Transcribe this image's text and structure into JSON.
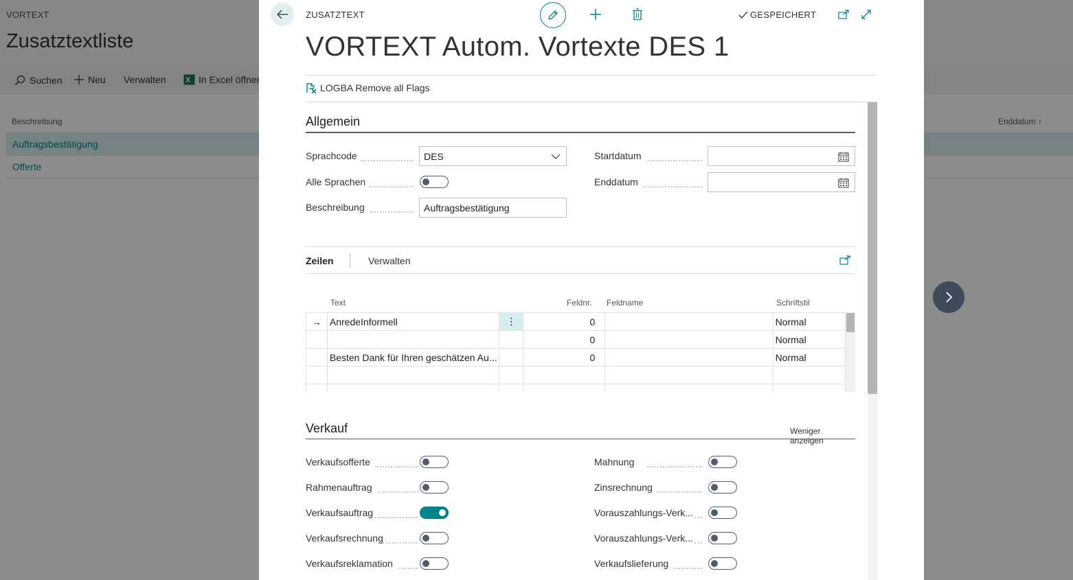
{
  "background": {
    "breadcrumb": "VORTEXT",
    "title": "Zusatztextliste",
    "actions": [
      "Suchen",
      "Neu",
      "Verwalten",
      "In Excel öffnen"
    ],
    "columns": {
      "description": "Beschreibung",
      "end_date": "Enddatum"
    },
    "rows": [
      "Auftragsbestätigung",
      "Offerte"
    ]
  },
  "dialog": {
    "breadcrumb": "ZUSATZTEXT",
    "status": "GESPEICHERT",
    "title": "VORTEXT Autom. Vortexte DES 1",
    "action": "LOGBA Remove all Flags"
  },
  "general": {
    "title": "Allgemein",
    "language_code_label": "Sprachcode",
    "language_code_value": "DES",
    "all_languages_label": "Alle Sprachen",
    "all_languages_on": false,
    "description_label": "Beschreibung",
    "description_value": "Auftragsbestätigung",
    "start_date_label": "Startdatum",
    "start_date_value": "",
    "end_date_label": "Enddatum",
    "end_date_value": ""
  },
  "lines": {
    "tab_lines": "Zeilen",
    "tab_manage": "Verwalten",
    "columns": {
      "text": "Text",
      "field_no": "Feldnr.",
      "field_name": "Feldname",
      "font_style": "Schriftstil"
    },
    "rows": [
      {
        "text": "AnredeInformell",
        "field_no": "0",
        "field_name": "",
        "font_style": "Normal"
      },
      {
        "text": "",
        "field_no": "0",
        "field_name": "",
        "font_style": "Normal"
      },
      {
        "text": "Besten Dank für Ihren geschätzen Au...",
        "field_no": "0",
        "field_name": "",
        "font_style": "Normal"
      },
      {
        "text": "",
        "field_no": "",
        "field_name": "",
        "font_style": ""
      },
      {
        "text": "",
        "field_no": "",
        "field_name": "",
        "font_style": ""
      }
    ]
  },
  "sales": {
    "title": "Verkauf",
    "show_less": "Weniger anzeigen",
    "left": [
      {
        "label": "Verkaufsofferte",
        "on": false
      },
      {
        "label": "Rahmenauftrag",
        "on": false
      },
      {
        "label": "Verkaufsauftrag",
        "on": true
      },
      {
        "label": "Verkaufsrechnung",
        "on": false
      },
      {
        "label": "Verkaufsreklamation",
        "on": false
      }
    ],
    "right": [
      {
        "label": "Mahnung",
        "on": false
      },
      {
        "label": "Zinsrechnung",
        "on": false
      },
      {
        "label": "Vorauszahlungs-Verk...",
        "on": false
      },
      {
        "label": "Vorauszahlungs-Verk...",
        "on": false
      },
      {
        "label": "Verkaufslieferung",
        "on": false
      }
    ]
  },
  "colors": {
    "accent": "#00838f",
    "dark": "#505c6d"
  }
}
